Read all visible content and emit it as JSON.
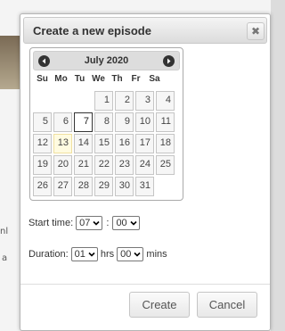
{
  "dialog": {
    "title": "Create a new episode",
    "close_symbol": "✖"
  },
  "background": {
    "fragment_1": "nl",
    "fragment_2": "a"
  },
  "calendar": {
    "month_label": "July 2020",
    "prev_icon": "chevron-left-icon",
    "next_icon": "chevron-right-icon",
    "weekdays": [
      "Su",
      "Mo",
      "Tu",
      "We",
      "Th",
      "Fr",
      "Sa"
    ],
    "leading_blanks": 3,
    "days": [
      "1",
      "2",
      "3",
      "4",
      "5",
      "6",
      "7",
      "8",
      "9",
      "10",
      "11",
      "12",
      "13",
      "14",
      "15",
      "16",
      "17",
      "18",
      "19",
      "20",
      "21",
      "22",
      "23",
      "24",
      "25",
      "26",
      "27",
      "28",
      "29",
      "30",
      "31"
    ],
    "today": "13",
    "selected": "7"
  },
  "start_time": {
    "label": "Start time:",
    "hour": "07",
    "separator": ":",
    "minute": "00"
  },
  "duration": {
    "label": "Duration:",
    "hours": "01",
    "hours_unit": "hrs",
    "minutes": "00",
    "minutes_unit": "mins"
  },
  "buttons": {
    "create": "Create",
    "cancel": "Cancel"
  }
}
